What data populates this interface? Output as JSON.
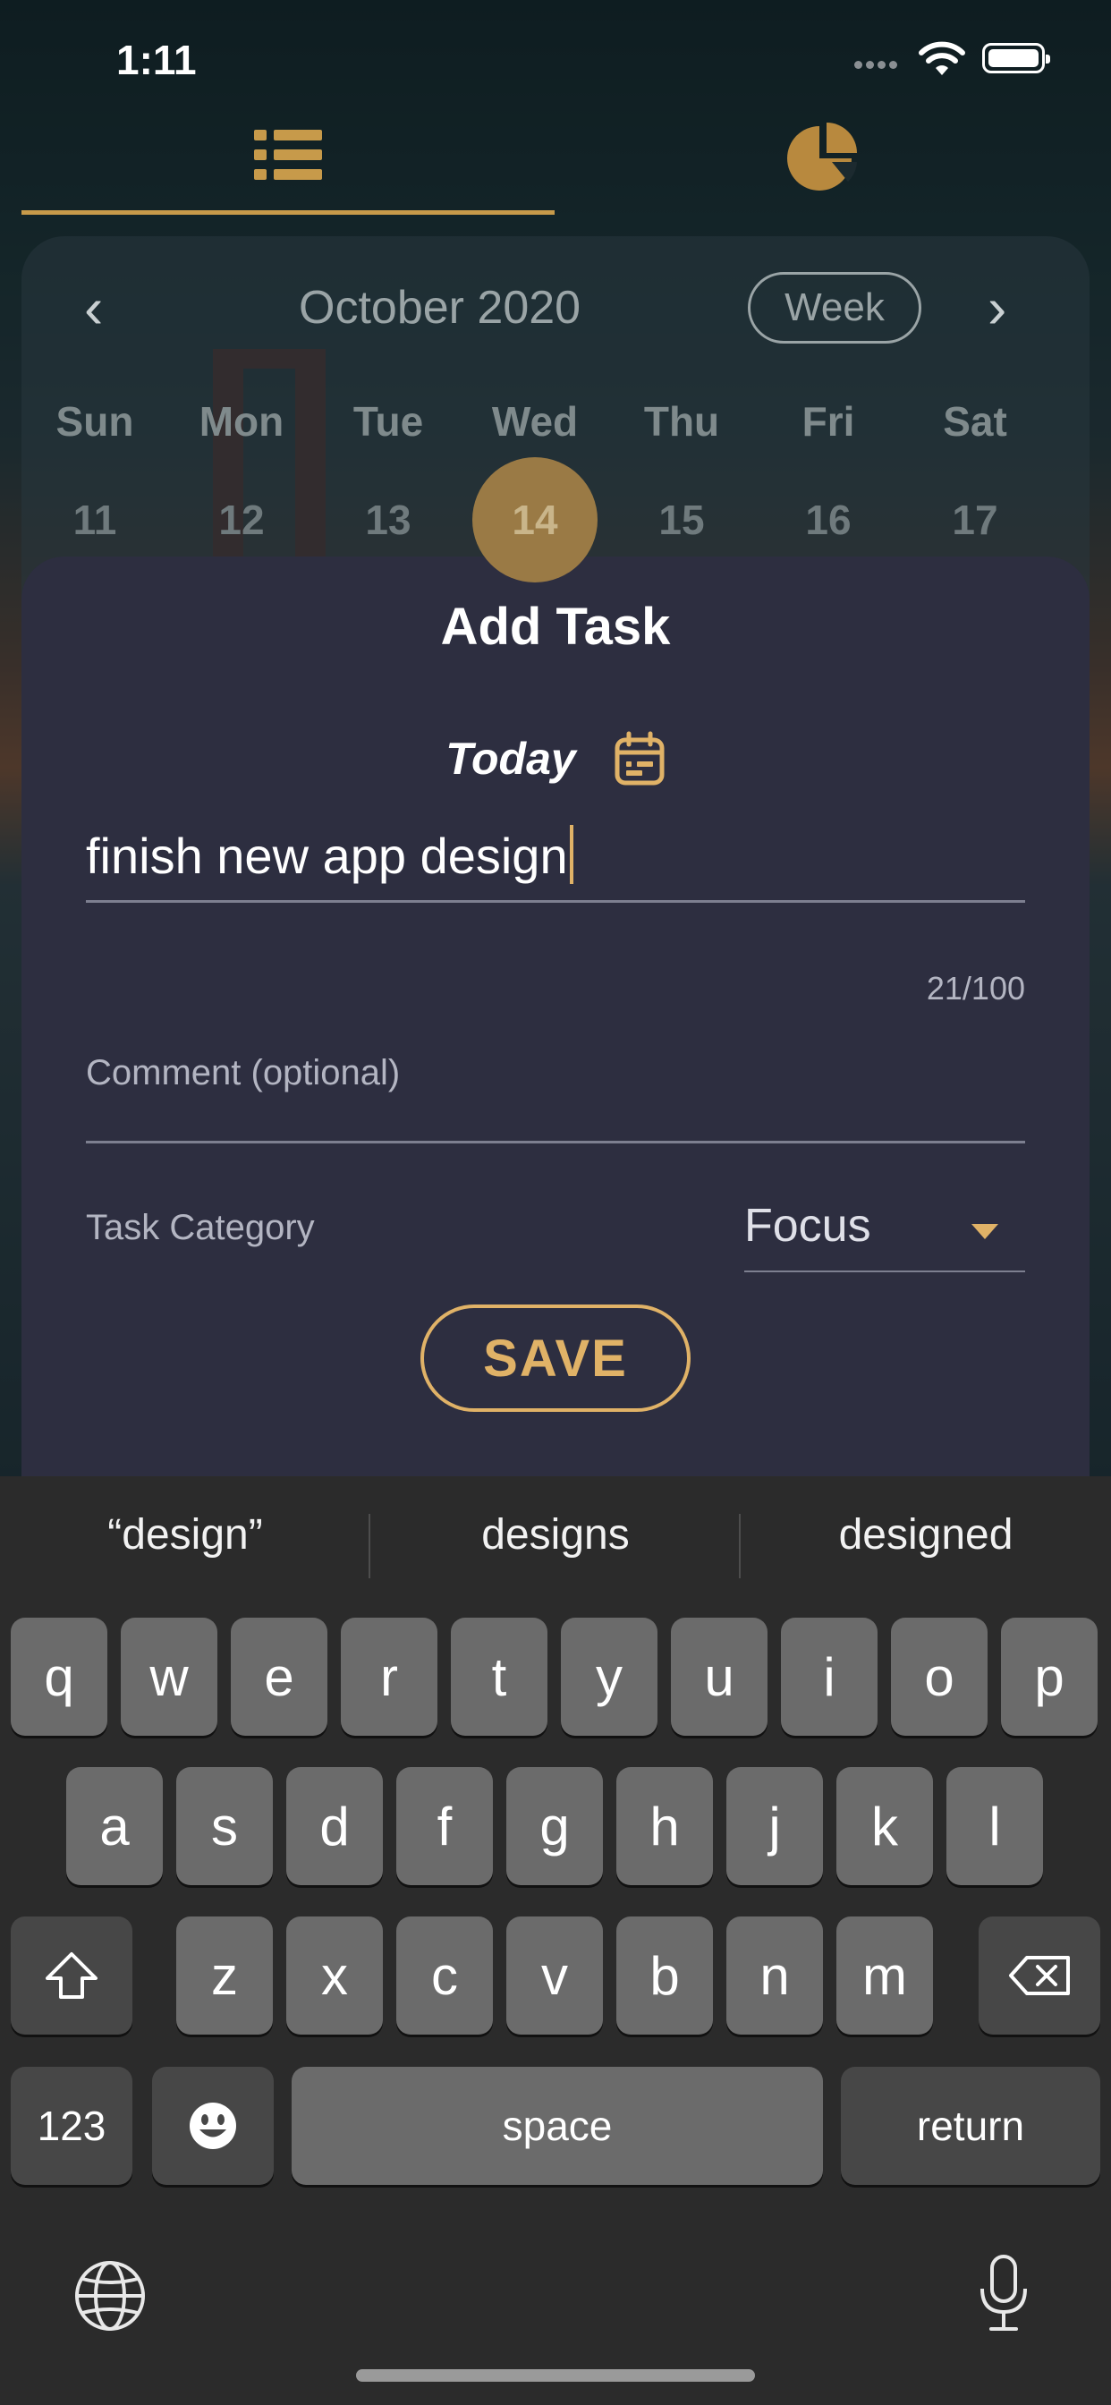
{
  "status_bar": {
    "time": "1:11"
  },
  "tabs": [
    {
      "name": "list-icon",
      "active": true
    },
    {
      "name": "pie-chart-icon",
      "active": false
    }
  ],
  "calendar": {
    "prev": "‹",
    "next": "›",
    "month": "October 2020",
    "view_button": "Week",
    "weekdays": [
      "Sun",
      "Mon",
      "Tue",
      "Wed",
      "Thu",
      "Fri",
      "Sat"
    ],
    "days": [
      "11",
      "12",
      "13",
      "14",
      "15",
      "16",
      "17"
    ],
    "selected_day": "14"
  },
  "add_task": {
    "title": "Add Task",
    "date_label": "Today",
    "task_value": "finish new app design",
    "counter": "21/100",
    "comment_placeholder": "Comment (optional)",
    "category_label": "Task Category",
    "category_value": "Focus",
    "save_label": "SAVE"
  },
  "keyboard": {
    "suggestions": [
      "“design”",
      "designs",
      "designed"
    ],
    "row1": [
      "q",
      "w",
      "e",
      "r",
      "t",
      "y",
      "u",
      "i",
      "o",
      "p"
    ],
    "row2": [
      "a",
      "s",
      "d",
      "f",
      "g",
      "h",
      "j",
      "k",
      "l"
    ],
    "row3": [
      "z",
      "x",
      "c",
      "v",
      "b",
      "n",
      "m"
    ],
    "numbers_key": "123",
    "space_key": "space",
    "return_key": "return"
  },
  "colors": {
    "accent": "#e0b267",
    "sheet": "#2d2e40",
    "keyboard": "#2b2b2b"
  }
}
